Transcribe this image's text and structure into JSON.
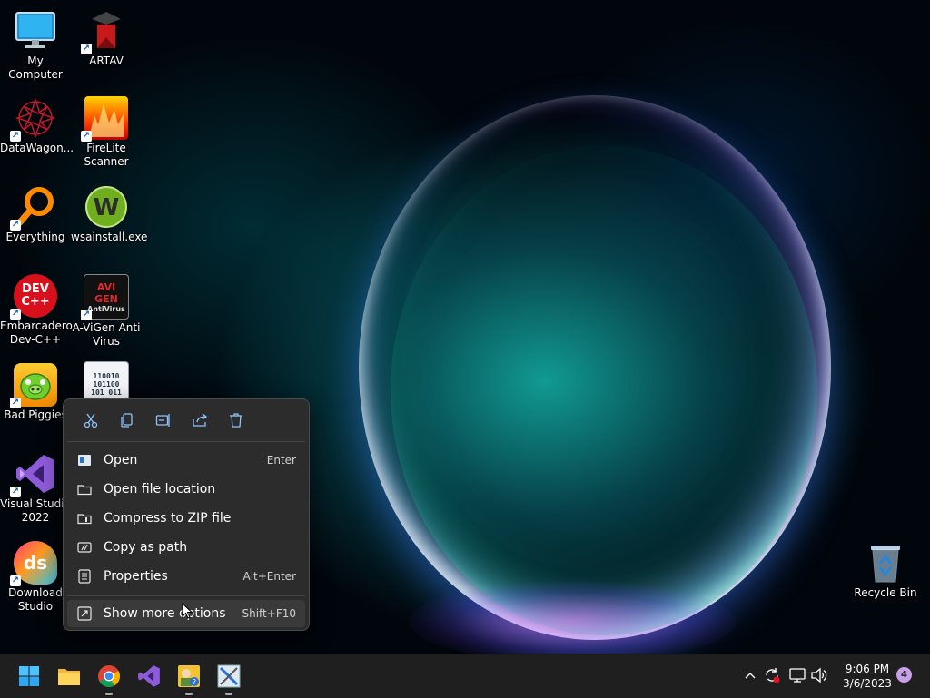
{
  "desktop": {
    "icons": [
      {
        "label": "My Computer"
      },
      {
        "label": "ARTAV"
      },
      {
        "label": "DataWagon..."
      },
      {
        "label": "FireLite Scanner"
      },
      {
        "label": "Everything"
      },
      {
        "label": "wsainstall.exe"
      },
      {
        "label": "Embarcadero Dev-C++"
      },
      {
        "label": "A-ViGen Anti Virus"
      },
      {
        "label": "Bad Piggies"
      },
      {
        "label": "Visual Studio 2022"
      },
      {
        "label": "Download Studio"
      },
      {
        "label": "Recycle Bin"
      }
    ],
    "avigen_logo_text": "AVI GEN",
    "avigen_logo_sub": "AntiVirus",
    "devcpp_logo_text": "DEV C++",
    "ds_logo_text": "ds",
    "binary_text": "110010 101100 101 011"
  },
  "context_menu": {
    "toolbar": [
      {
        "name": "cut",
        "icon": "scissors-icon"
      },
      {
        "name": "copy",
        "icon": "copy-icon"
      },
      {
        "name": "rename",
        "icon": "rename-icon"
      },
      {
        "name": "share",
        "icon": "share-icon"
      },
      {
        "name": "delete",
        "icon": "trash-icon"
      }
    ],
    "items": [
      {
        "label": "Open",
        "shortcut": "Enter",
        "icon": "open-icon"
      },
      {
        "label": "Open file location",
        "shortcut": "",
        "icon": "folder-icon"
      },
      {
        "label": "Compress to ZIP file",
        "shortcut": "",
        "icon": "zip-icon"
      },
      {
        "label": "Copy as path",
        "shortcut": "",
        "icon": "path-icon"
      },
      {
        "label": "Properties",
        "shortcut": "Alt+Enter",
        "icon": "properties-icon"
      },
      {
        "label": "Show more options",
        "shortcut": "Shift+F10",
        "icon": "more-options-icon"
      }
    ]
  },
  "taskbar": {
    "clock_time": "9:06 PM",
    "clock_date": "3/6/2023",
    "notification_count": "4"
  },
  "colors": {
    "accent": "#0078d4",
    "menu_bg": "#2c2c2c",
    "taskbar_bg": "#1f1f1f"
  }
}
